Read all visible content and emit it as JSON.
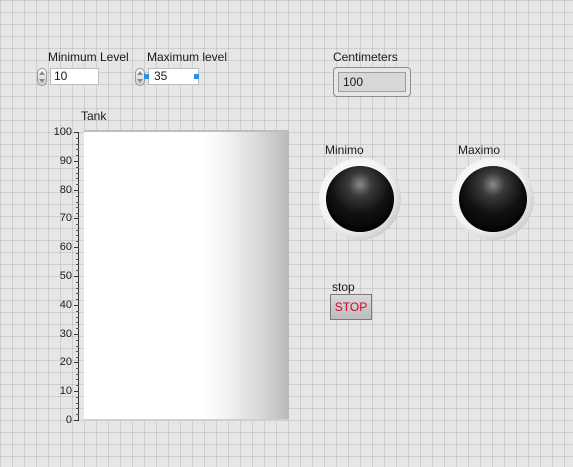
{
  "controls": {
    "min_level": {
      "label": "Minimum Level",
      "value": "10"
    },
    "max_level": {
      "label": "Maximum level",
      "value": "35"
    }
  },
  "indicator": {
    "label": "Centimeters",
    "value": "100"
  },
  "tank": {
    "label": "Tank",
    "scale_labels": [
      "100",
      "90",
      "80",
      "70",
      "60",
      "50",
      "40",
      "30",
      "20",
      "10",
      "0"
    ],
    "scale_range": [
      0,
      100
    ],
    "level": 100
  },
  "leds": {
    "minimo": {
      "label": "Minimo",
      "state": "off"
    },
    "maximo": {
      "label": "Maximo",
      "state": "off"
    }
  },
  "stop": {
    "label": "stop",
    "button_text": "STOP"
  },
  "colors": {
    "stop_text": "#e0002b",
    "selection_handle": "#2e8ee6",
    "led_off": "#000000"
  }
}
